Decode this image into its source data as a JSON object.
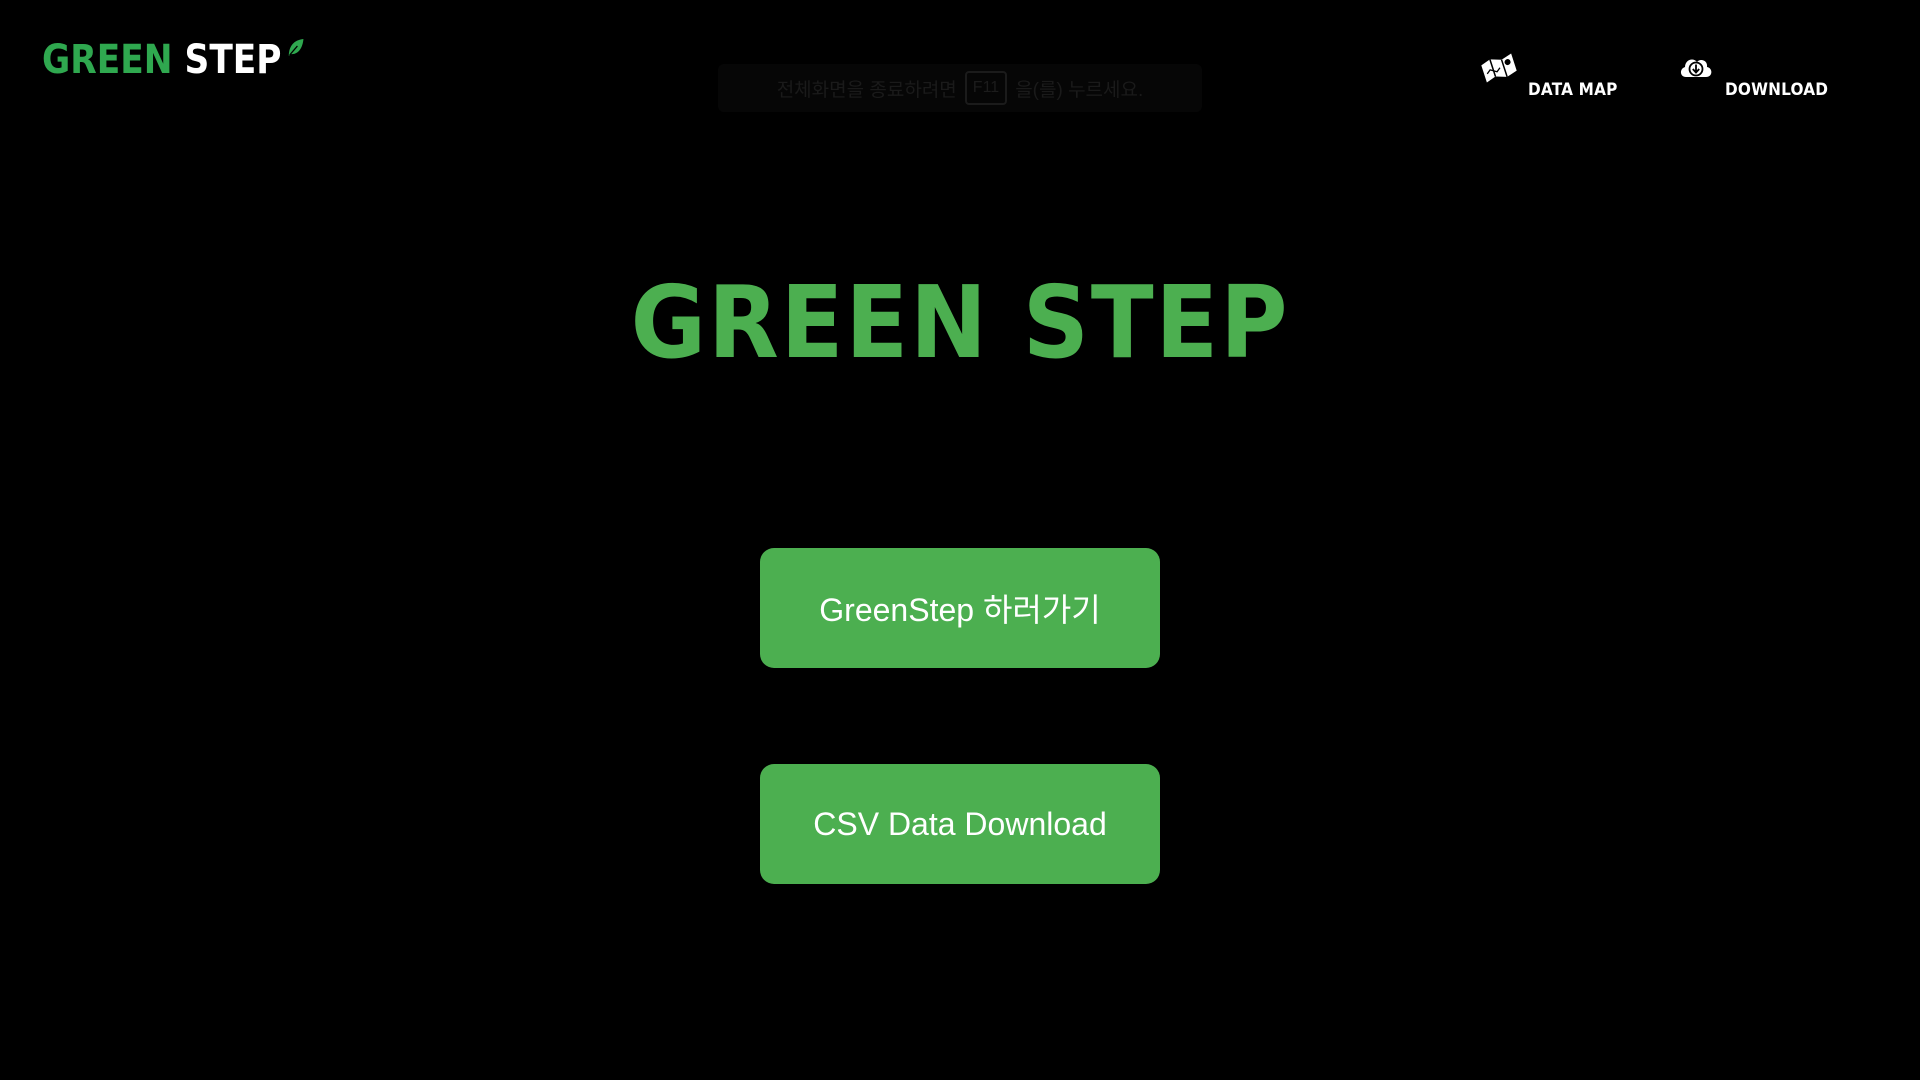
{
  "header": {
    "logo": {
      "part1": "GREEN",
      "part2": "STEP"
    },
    "fullscreen_hint": {
      "before": "전체화면을 종료하려면",
      "key": "F11",
      "after": "을(를) 누르세요."
    },
    "nav": [
      {
        "label": "DATA MAP",
        "icon": "map-icon"
      },
      {
        "label": "DOWNLOAD",
        "icon": "cloud-download-icon"
      }
    ]
  },
  "main": {
    "title": "GREEN STEP",
    "buttons": {
      "go_label": "GreenStep 하러가기",
      "csv_label": "CSV Data Download"
    }
  },
  "colors": {
    "background": "#000000",
    "accent": "#4caf50",
    "logo_green": "#2fa84f"
  }
}
